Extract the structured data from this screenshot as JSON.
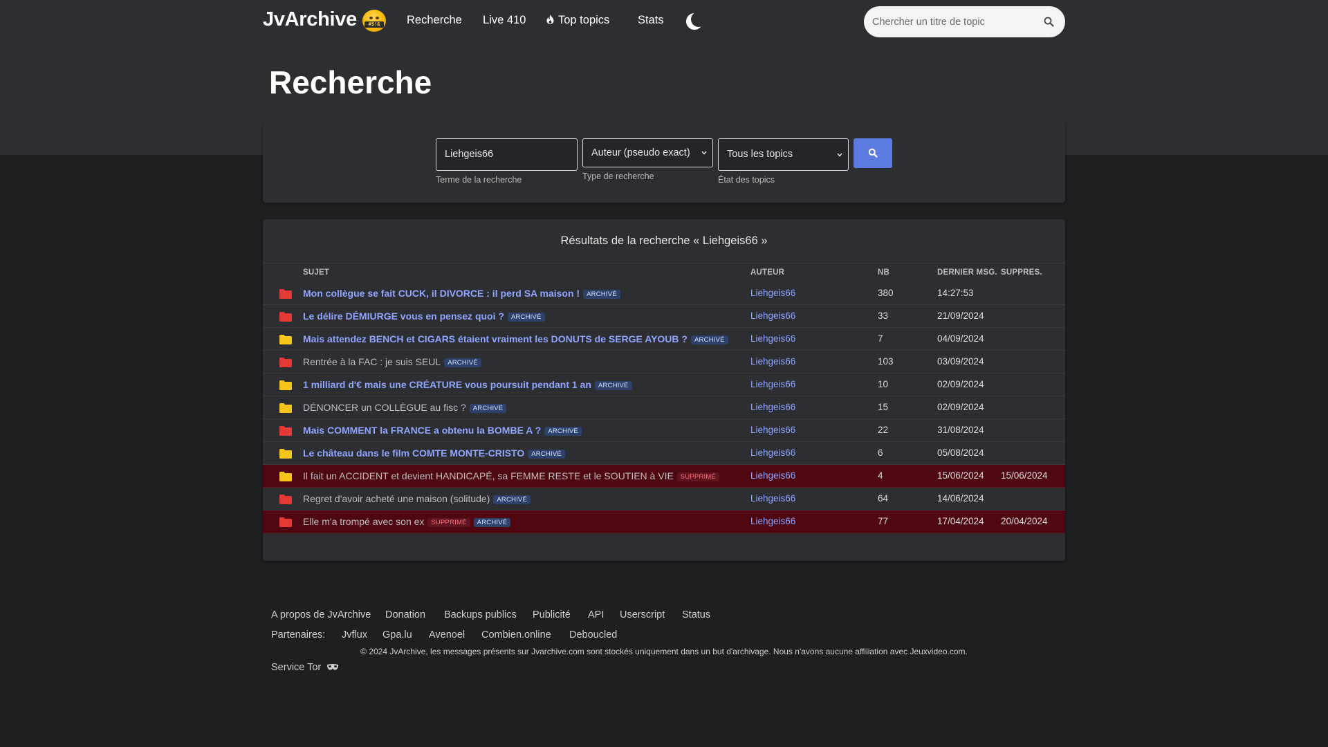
{
  "nav": {
    "brand": "JvArchive",
    "brand_badge": "#$!&",
    "links": [
      "Recherche",
      "Live 410",
      "Top topics",
      "Stats"
    ],
    "search_placeholder": "Chercher un titre de topic"
  },
  "page_title": "Recherche",
  "search_form": {
    "term_value": "Liehgeis66",
    "term_help": "Terme de la recherche",
    "type_value": "Auteur (pseudo exact)",
    "type_help": "Type de recherche",
    "state_value": "Tous les topics",
    "state_help": "État des topics"
  },
  "results": {
    "title": "Résultats de la recherche « Liehgeis66 »",
    "columns": {
      "subject": "SUJET",
      "author": "AUTEUR",
      "nb": "NB",
      "last": "DERNIER MSG.",
      "deleted": "SUPPRES."
    },
    "rows": [
      {
        "folder": "red",
        "title": "Mon collègue se fait CUCK, il DIVORCE : il perd SA maison !",
        "bold": true,
        "deleted_badge": "",
        "archive_badge": "ARCHIVÉ",
        "author": "Liehgeis66",
        "nb": "380",
        "last": "14:27:53",
        "deleted": "",
        "row_deleted": false
      },
      {
        "folder": "red",
        "title": "Le délire DÉMIURGE vous en pensez quoi ?",
        "bold": true,
        "deleted_badge": "",
        "archive_badge": "ARCHIVÉ",
        "author": "Liehgeis66",
        "nb": "33",
        "last": "21/09/2024",
        "deleted": "",
        "row_deleted": false
      },
      {
        "folder": "yellow",
        "title": "Mais attendez BENCH et CIGARS étaient vraiment les DONUTS de SERGE AYOUB ?",
        "bold": true,
        "deleted_badge": "",
        "archive_badge": "ARCHIVÉ",
        "author": "Liehgeis66",
        "nb": "7",
        "last": "04/09/2024",
        "deleted": "",
        "row_deleted": false
      },
      {
        "folder": "red",
        "title": "Rentrée à la FAC : je suis SEUL",
        "bold": false,
        "deleted_badge": "",
        "archive_badge": "ARCHIVÉ",
        "author": "Liehgeis66",
        "nb": "103",
        "last": "03/09/2024",
        "deleted": "",
        "row_deleted": false
      },
      {
        "folder": "yellow",
        "title": "1 milliard d'€ mais une CRÉATURE vous poursuit pendant 1 an",
        "bold": true,
        "deleted_badge": "",
        "archive_badge": "ARCHIVÉ",
        "author": "Liehgeis66",
        "nb": "10",
        "last": "02/09/2024",
        "deleted": "",
        "row_deleted": false
      },
      {
        "folder": "yellow",
        "title": "DÉNONCER un COLLÈGUE au fisc ?",
        "bold": false,
        "deleted_badge": "",
        "archive_badge": "ARCHIVÉ",
        "author": "Liehgeis66",
        "nb": "15",
        "last": "02/09/2024",
        "deleted": "",
        "row_deleted": false
      },
      {
        "folder": "red",
        "title": "Mais COMMENT la FRANCE a obtenu la BOMBE A ?",
        "bold": true,
        "deleted_badge": "",
        "archive_badge": "ARCHIVÉ",
        "author": "Liehgeis66",
        "nb": "22",
        "last": "31/08/2024",
        "deleted": "",
        "row_deleted": false
      },
      {
        "folder": "yellow",
        "title": "Le château dans le film COMTE MONTE-CRISTO",
        "bold": true,
        "deleted_badge": "",
        "archive_badge": "ARCHIVÉ",
        "author": "Liehgeis66",
        "nb": "6",
        "last": "05/08/2024",
        "deleted": "",
        "row_deleted": false
      },
      {
        "folder": "yellow",
        "title": "Il fait un ACCIDENT et devient HANDICAPÉ, sa FEMME RESTE et le SOUTIEN à VIE",
        "bold": false,
        "deleted_badge": "SUPPRIMÉ",
        "archive_badge": "",
        "author": "Liehgeis66",
        "nb": "4",
        "last": "15/06/2024",
        "deleted": "15/06/2024",
        "row_deleted": true
      },
      {
        "folder": "red",
        "title": "Regret d'avoir acheté une maison (solitude)",
        "bold": false,
        "deleted_badge": "",
        "archive_badge": "ARCHIVÉ",
        "author": "Liehgeis66",
        "nb": "64",
        "last": "14/06/2024",
        "deleted": "",
        "row_deleted": false
      },
      {
        "folder": "red",
        "title": "Elle m'a trompé avec son ex",
        "bold": false,
        "deleted_badge": "SUPPRIMÉ",
        "archive_badge": "ARCHIVÉ",
        "author": "Liehgeis66",
        "nb": "77",
        "last": "17/04/2024",
        "deleted": "20/04/2024",
        "row_deleted": true
      }
    ]
  },
  "footer": {
    "links": [
      "A propos de JvArchive",
      "Donation",
      "Backups publics",
      "Publicité",
      "API",
      "Userscript",
      "Status"
    ],
    "partners_label": "Partenaires:",
    "partners": [
      "Jvflux",
      "Gpa.lu",
      "Avenoel",
      "Combien.online",
      "Deboucled"
    ],
    "copyright": "© 2024 JvArchive, les messages présents sur Jvarchive.com sont stockés uniquement dans un but d'archivage. Nous n'avons aucune affiliation avec Jeuxvideo.com.",
    "tor": "Service Tor"
  },
  "colors": {
    "accent": "#5b7be0",
    "link": "#8ea4ff",
    "folder_red": "#e53935",
    "folder_yellow": "#f5c518",
    "deleted_row": "#4f0711"
  }
}
